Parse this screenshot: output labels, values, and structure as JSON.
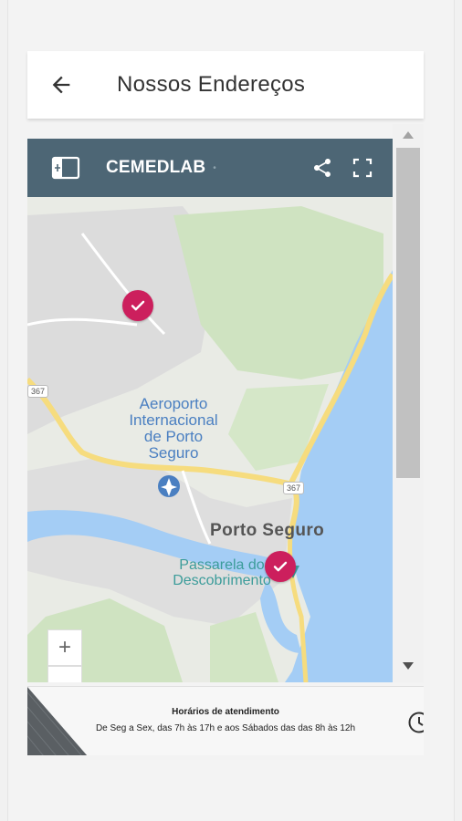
{
  "header": {
    "title": "Nossos Endereços",
    "back_icon": "arrow-left-icon"
  },
  "map": {
    "name": "CEMEDLAB",
    "toolbar_icons": [
      "map-legend-icon",
      "share-icon",
      "fullscreen-icon"
    ],
    "labels": {
      "airport": "Aeroporto Internacional de Porto Seguro",
      "city": "Porto Seguro",
      "passarela": "Passarela do Descobrimento"
    },
    "road_shields": [
      "367",
      "367"
    ],
    "zoom_in_label": "+",
    "zoom_out_label": "−"
  },
  "hours": {
    "title": "Horários de atendimento",
    "text": "De Seg a Sex, das 7h às 17h e aos Sábados das das 8h às 12h"
  },
  "colors": {
    "toolbar": "#4d6675",
    "marker": "#cc1f5d",
    "water": "#a4cdf5",
    "road": "#f6dc7e"
  }
}
